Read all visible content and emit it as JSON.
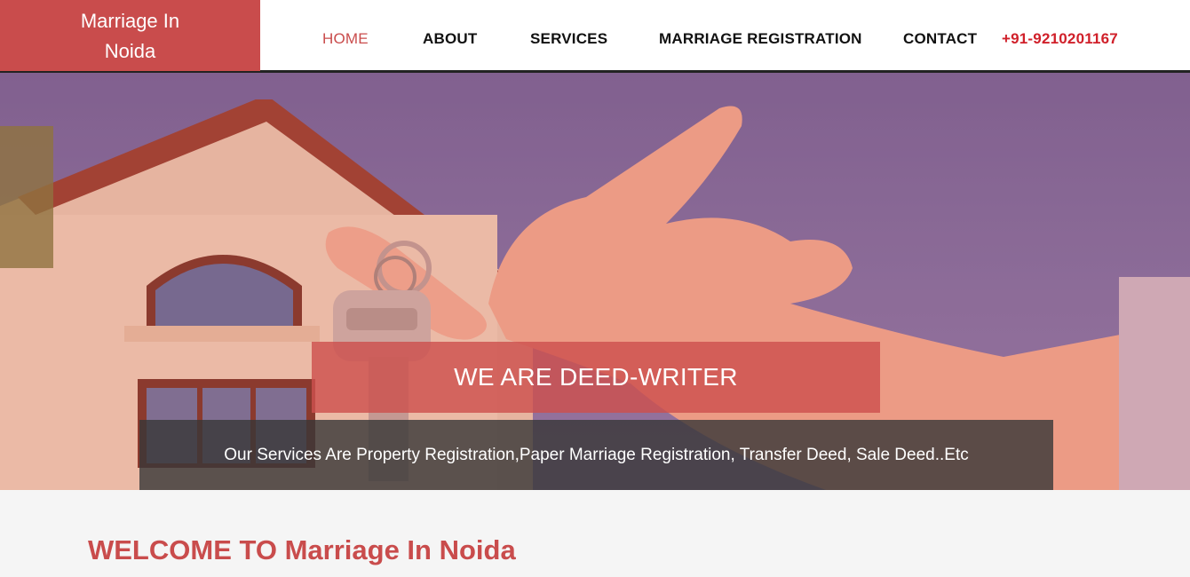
{
  "brand": {
    "line1": "Marriage In",
    "line2": "Noida",
    "color": "#c94c4c"
  },
  "nav": {
    "items": [
      {
        "label": "HOME",
        "active": true
      },
      {
        "label": "ABOUT"
      },
      {
        "label": "SERVICES"
      },
      {
        "label": "MARRIAGE REGISTRATION"
      },
      {
        "label": "CONTACT"
      }
    ],
    "phone": "+91-9210201167"
  },
  "hero": {
    "title": "WE ARE DEED-WRITER",
    "subtitle": "Our Services Are Property Registration,Paper Marriage Registration, Transfer Deed, Sale Deed..Etc",
    "image": "hand-holding-house-key"
  },
  "welcome": {
    "heading": "WELCOME TO Marriage In Noida"
  }
}
